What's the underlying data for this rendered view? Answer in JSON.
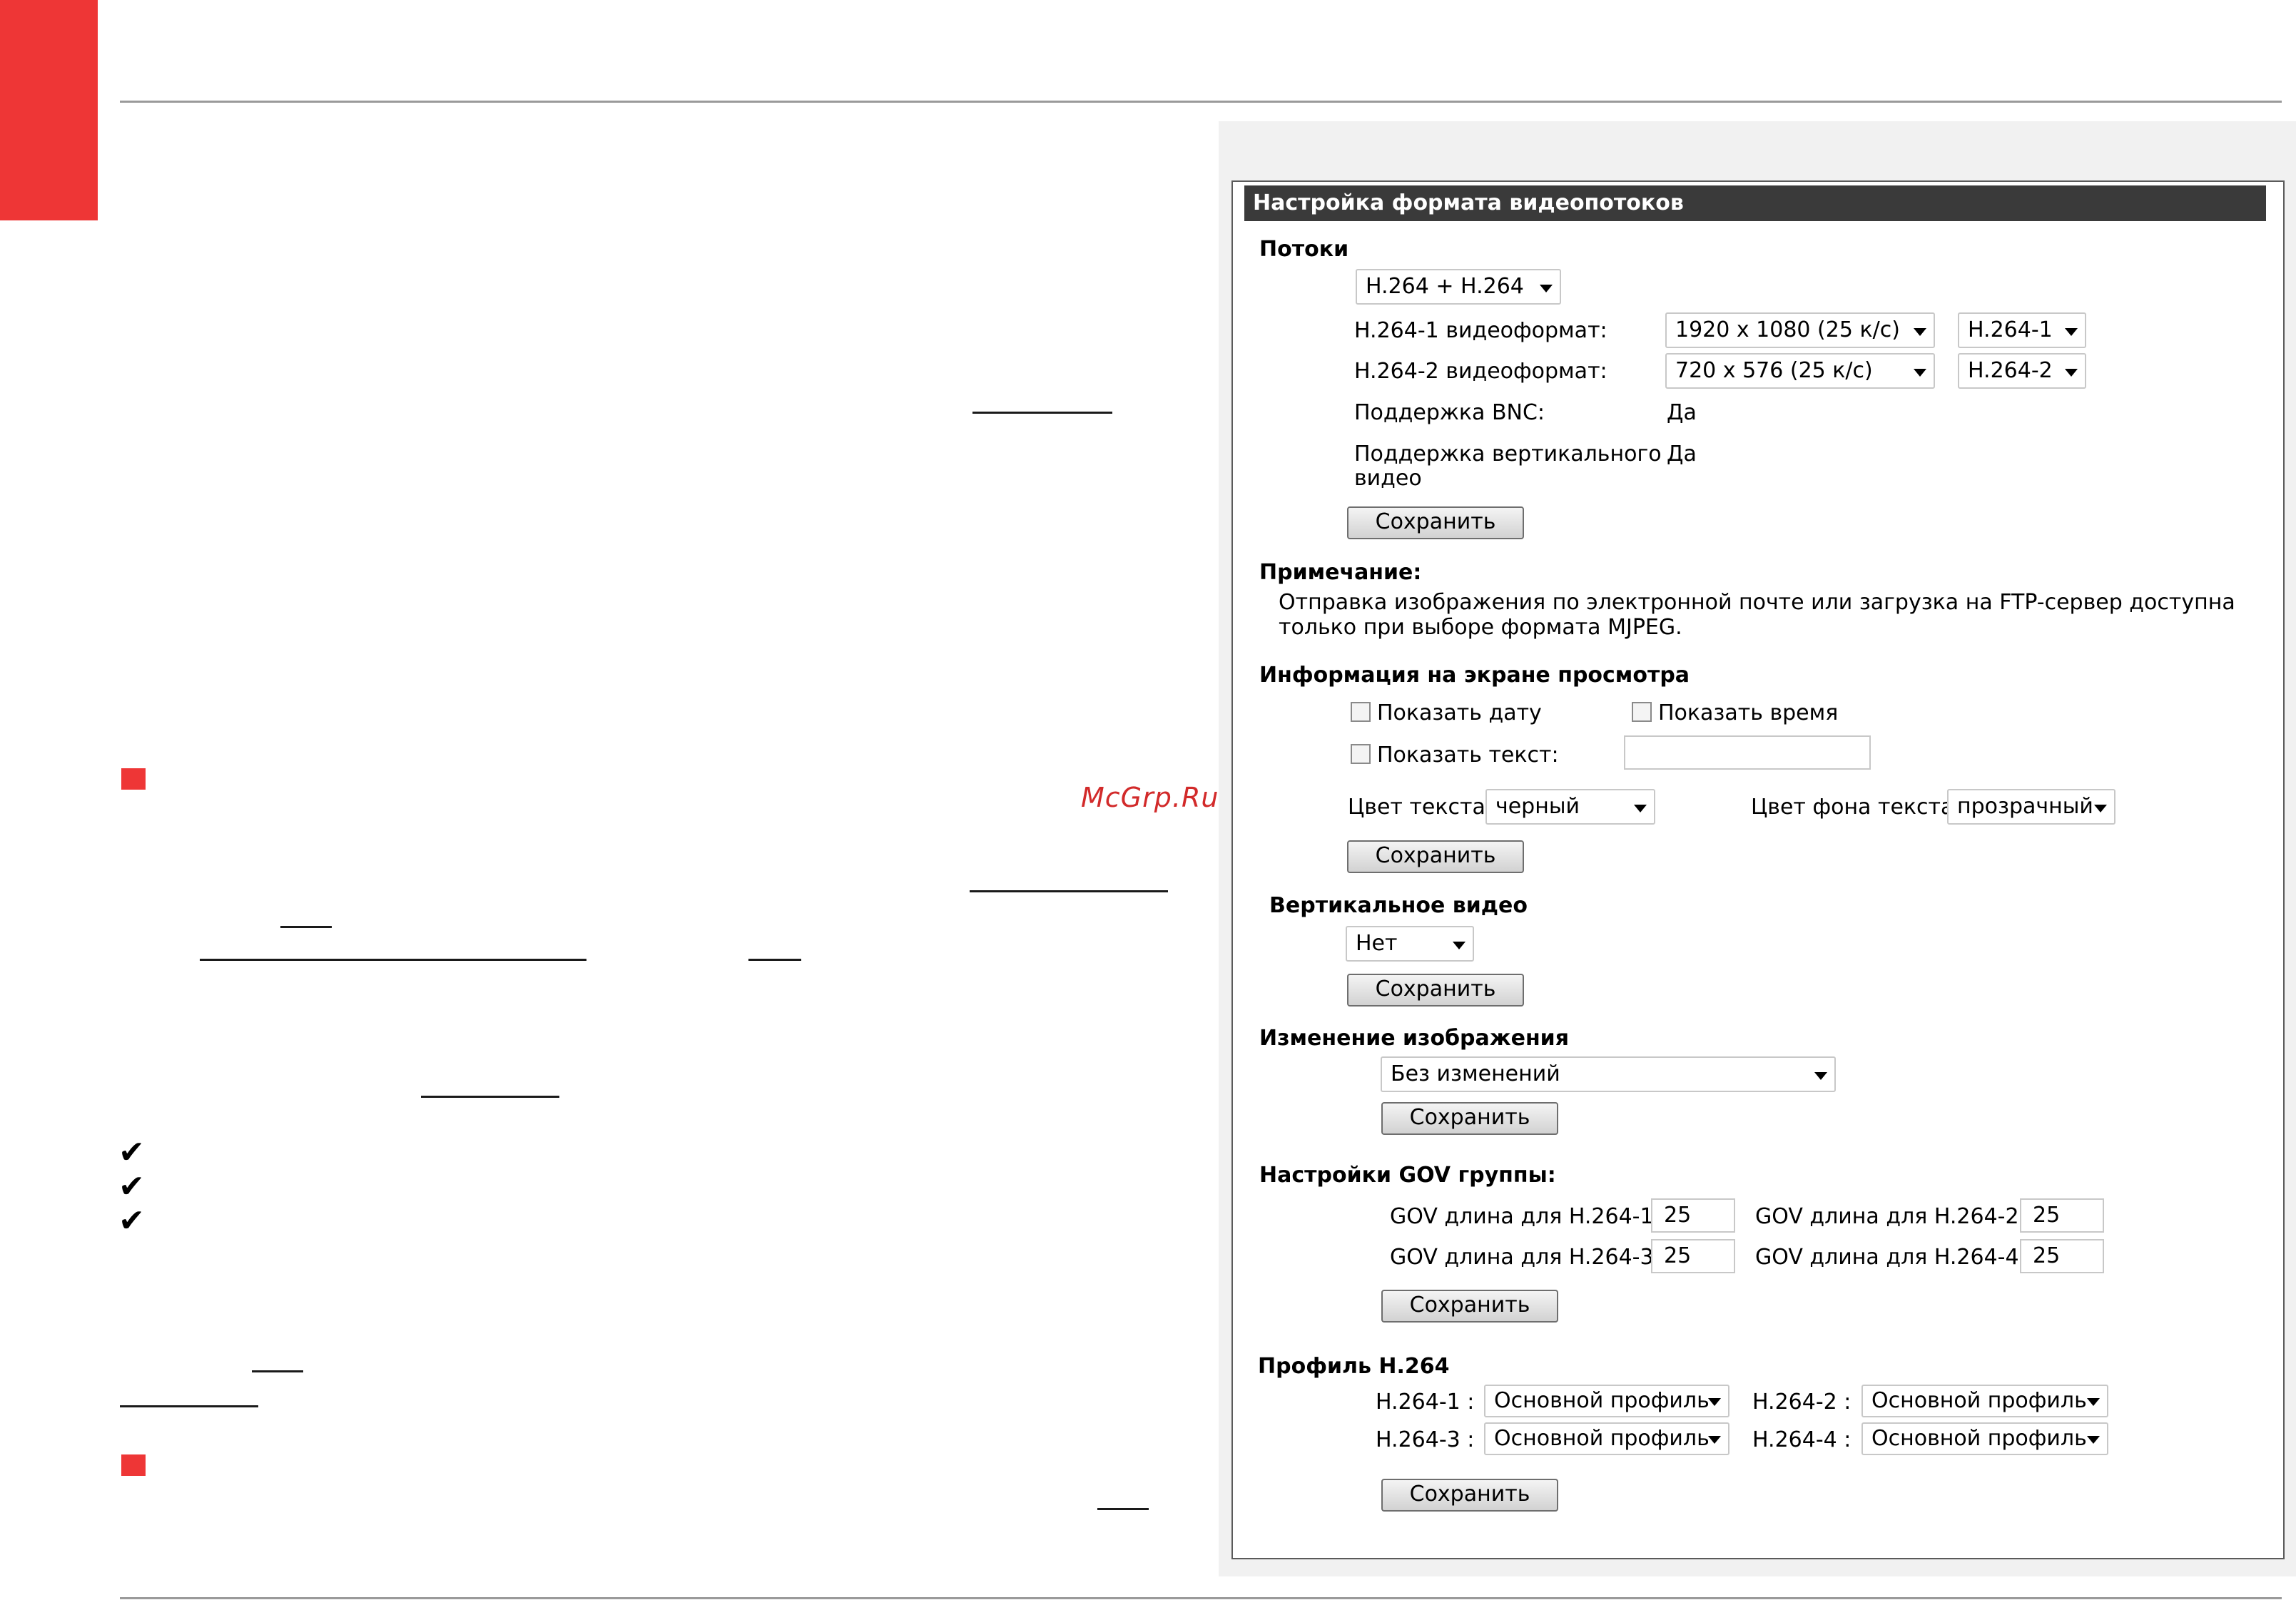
{
  "watermark": "McGrp.Ru",
  "panel": {
    "title": "Настройка формата видеопотоков",
    "streams": {
      "heading": "Потоки",
      "mode": "H.264 + H.264",
      "fmt1_label": "H.264-1 видеоформат:",
      "fmt1_value": "1920 x 1080 (25 к/с)",
      "fmt1_codec": "H.264-1",
      "fmt2_label": "H.264-2 видеоформат:",
      "fmt2_value": "720 x 576 (25 к/с)",
      "fmt2_codec": "H.264-2",
      "bnc_label": "Поддержка BNC:",
      "bnc_value": "Да",
      "vert_label_line1": "Поддержка вертикального",
      "vert_label_line2": "видео",
      "vert_value": "Да",
      "save": "Сохранить"
    },
    "note": {
      "heading": "Примечание:",
      "line1": "Отправка изображения по электронной почте или загрузка на FTP-сервер доступна",
      "line2": "только при выборе формата MJPEG."
    },
    "osd": {
      "heading": "Информация на экране просмотра",
      "show_date": "Показать дату",
      "show_time": "Показать время",
      "show_text": "Показать текст:",
      "text_value": "",
      "text_color_label": "Цвет текста",
      "text_color_value": "черный",
      "bg_color_label": "Цвет фона текста",
      "bg_color_value": "прозрачный",
      "save": "Сохранить"
    },
    "vertical": {
      "heading": "Вертикальное видео",
      "value": "Нет",
      "save": "Сохранить"
    },
    "image_change": {
      "heading": "Изменение изображения",
      "value": "Без изменений",
      "save": "Сохранить"
    },
    "gov": {
      "heading": "Настройки GOV группы:",
      "l1": "GOV длина для H.264-1",
      "v1": "25",
      "l2": "GOV длина для H.264-2",
      "v2": "25",
      "l3": "GOV длина для H.264-3",
      "v3": "25",
      "l4": "GOV длина для H.264-4",
      "v4": "25",
      "save": "Сохранить"
    },
    "profile": {
      "heading": "Профиль H.264",
      "l1": "H.264-1 :",
      "v1": "Основной профиль",
      "l2": "H.264-2 :",
      "v2": "Основной профиль",
      "l3": "H.264-3 :",
      "v3": "Основной профиль",
      "l4": "H.264-4 :",
      "v4": "Основной профиль",
      "save": "Сохранить"
    }
  }
}
